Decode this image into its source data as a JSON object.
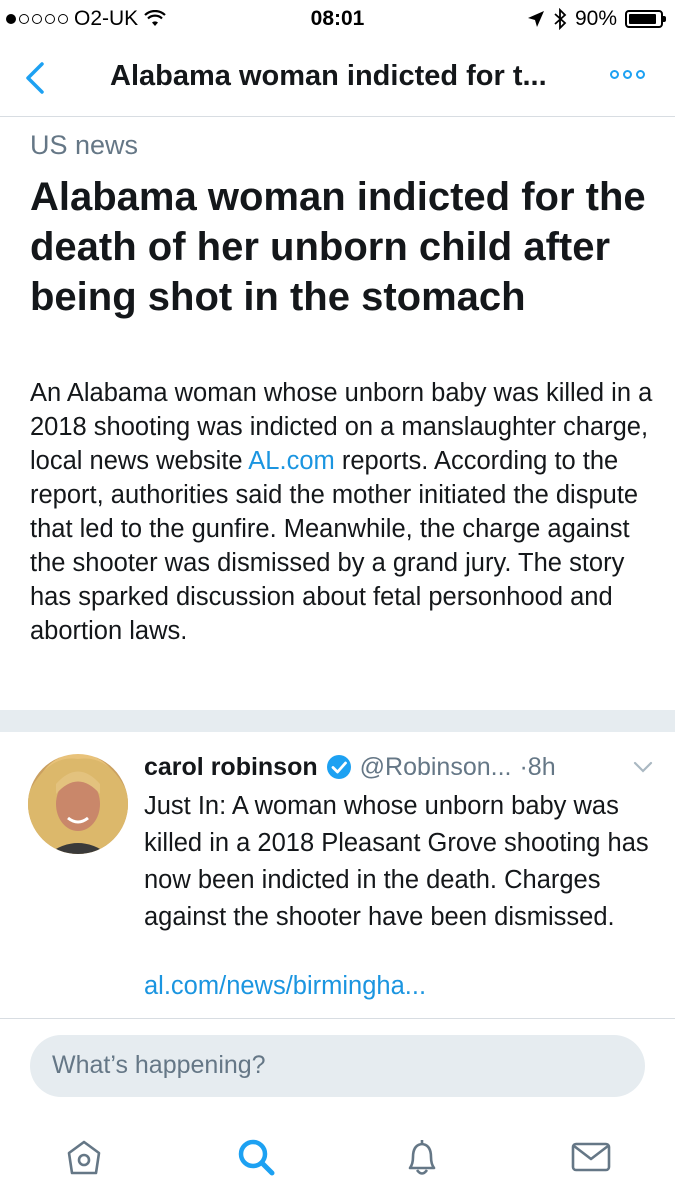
{
  "status_bar": {
    "carrier": "O2-UK",
    "time": "08:01",
    "battery": "90%",
    "battery_level": 0.9,
    "signal_bars_filled": 1,
    "signal_bars_total": 5
  },
  "nav": {
    "title": "Alabama woman indicted for t...",
    "back_icon": "chevron-left-icon",
    "more_icon": "more-dots-icon"
  },
  "article": {
    "category": "US news",
    "headline": "Alabama woman indicted for the death of her unborn child after being shot in the stomach",
    "summary_before_link": "An Alabama woman whose unborn baby was killed in a 2018 shooting was indicted on a manslaughter charge, local news website ",
    "summary_link": "AL.com",
    "summary_after_link": " reports. According to the report, authorities said the mother initiated the dispute that led to the gunfire. Meanwhile, the charge against the shooter was dismissed by a grand jury. The story has sparked discussion about fetal personhood and abortion laws."
  },
  "tweet": {
    "author": "carol robinson",
    "handle": "@Robinson...",
    "time": "·8h",
    "text": "Just In: A woman whose unborn baby was killed in a 2018 Pleasant Grove shooting has now been indicted in the death. Charges against the shooter have been dismissed.",
    "link": "al.com/news/birmingha..."
  },
  "compose": {
    "placeholder": "What’s happening?"
  },
  "tabs": [
    "home-icon",
    "search-icon",
    "notifications-icon",
    "messages-icon"
  ],
  "colors": {
    "accent": "#1da1f2",
    "link": "#1b95e0",
    "secondary_text": "#657786",
    "divider": "#e6ecf0"
  }
}
